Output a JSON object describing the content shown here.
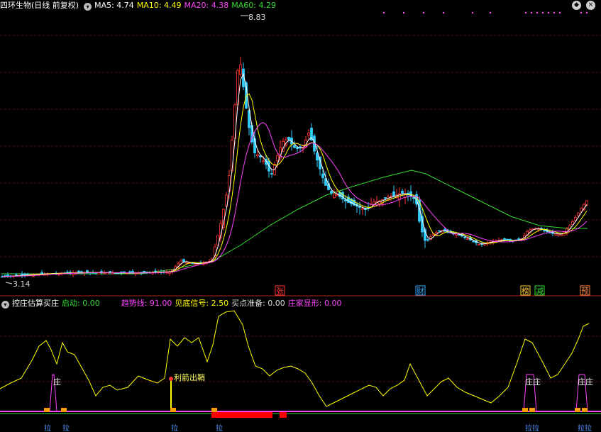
{
  "header": {
    "title": "四环生物(日线 前复权)",
    "ma": [
      {
        "label": "MA5: 4.74",
        "color": "#ffffff"
      },
      {
        "label": "MA10: 4.49",
        "color": "#ffff00"
      },
      {
        "label": "MA20: 4.38",
        "color": "#ff44ff"
      },
      {
        "label": "MA60: 4.29",
        "color": "#33dd33"
      }
    ]
  },
  "indicator_header": {
    "title": "控庄估算买庄",
    "items": [
      {
        "label": "启动: 0.00",
        "color": "#33dd33"
      },
      {
        "label": "趋势线: 91.00",
        "color": "#ff44ff"
      },
      {
        "label": "见底信号: 2.50",
        "color": "#ffff00"
      },
      {
        "label": "买点准备: 0.00",
        "color": "#dddddd"
      },
      {
        "label": "庄家显形: 0.00",
        "color": "#ff44ff"
      }
    ]
  },
  "icons": {
    "settings": "chevron-down-icon",
    "corner_left": "diamond-icon",
    "corner_right": "close-icon"
  },
  "chart_data": [
    {
      "type": "candlestick",
      "title": "四环生物(日线 前复权)",
      "annotations": {
        "high": "8.83",
        "low": "3.14"
      },
      "event_markers": [
        {
          "label": "张",
          "color": "#ff3333"
        },
        {
          "label": "财",
          "color": "#33aaff"
        },
        {
          "label": "榜",
          "color": "#ffcc33"
        },
        {
          "label": "减",
          "color": "#33dd33"
        },
        {
          "label": "预",
          "color": "#ff8844"
        }
      ],
      "grid": "horizontal-dashed",
      "colors": {
        "up": "#ff3333",
        "down": "#33ccff",
        "ma5": "#ffffff",
        "ma10": "#ffff00",
        "ma20": "#ff44ff",
        "ma60": "#33dd33"
      }
    },
    {
      "type": "line",
      "title": "控庄估算买庄",
      "labels": [
        "庄",
        "利箭出鞘",
        "庄庄",
        "庄庄"
      ],
      "bottom_labels": [
        "拉",
        "拉",
        "拉",
        "拉",
        "拉拉",
        "拉拉"
      ],
      "colors": {
        "line": "#ffff00",
        "signal": "#ff44ff",
        "block": "#ff0000",
        "marker": "#ff9900"
      }
    }
  ]
}
